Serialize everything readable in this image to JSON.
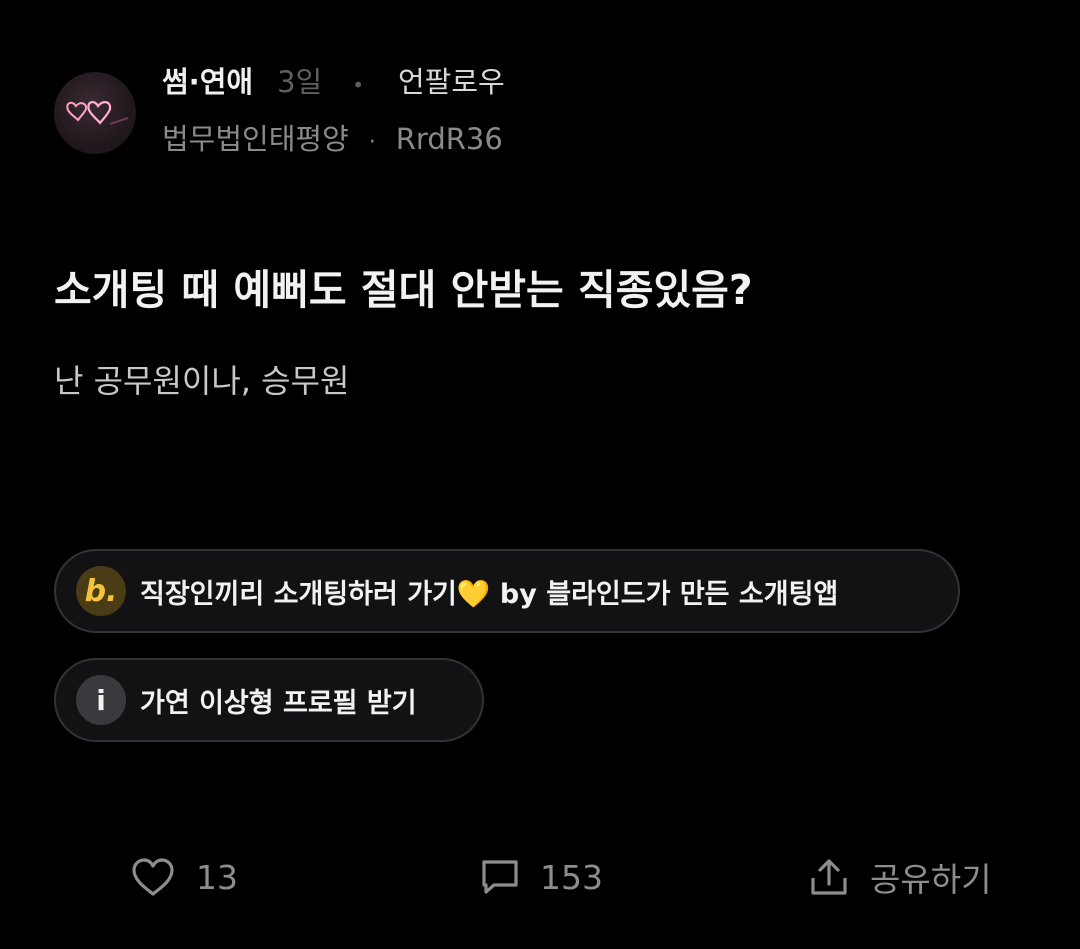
{
  "post": {
    "category": "썸·연애",
    "time": "3일",
    "separator": "•",
    "unfollow_label": "언팔로우",
    "author_company": "법무법인태평양",
    "author_separator": "·",
    "author_id": "RrdR36",
    "title": "소개팅 때 예뻐도 절대 안받는 직종있음?",
    "body": "난 공무원이나, 승무원"
  },
  "chips": [
    {
      "icon_text": "b.",
      "label": "직장인끼리 소개팅하러 가기💛 by 블라인드가 만든 소개팅앱"
    },
    {
      "icon_text": "i",
      "label": "가연 이상형 프로필 받기"
    }
  ],
  "actions": {
    "like_count": "13",
    "comment_count": "153",
    "share_label": "공유하기"
  },
  "colors": {
    "background": "#000000",
    "accent_yellow": "#f5c23d",
    "muted": "#8d8d8d"
  },
  "icons": {
    "avatar": "neon-hearts-avatar",
    "like": "heart-icon",
    "comment": "comment-icon",
    "share": "share-icon"
  }
}
